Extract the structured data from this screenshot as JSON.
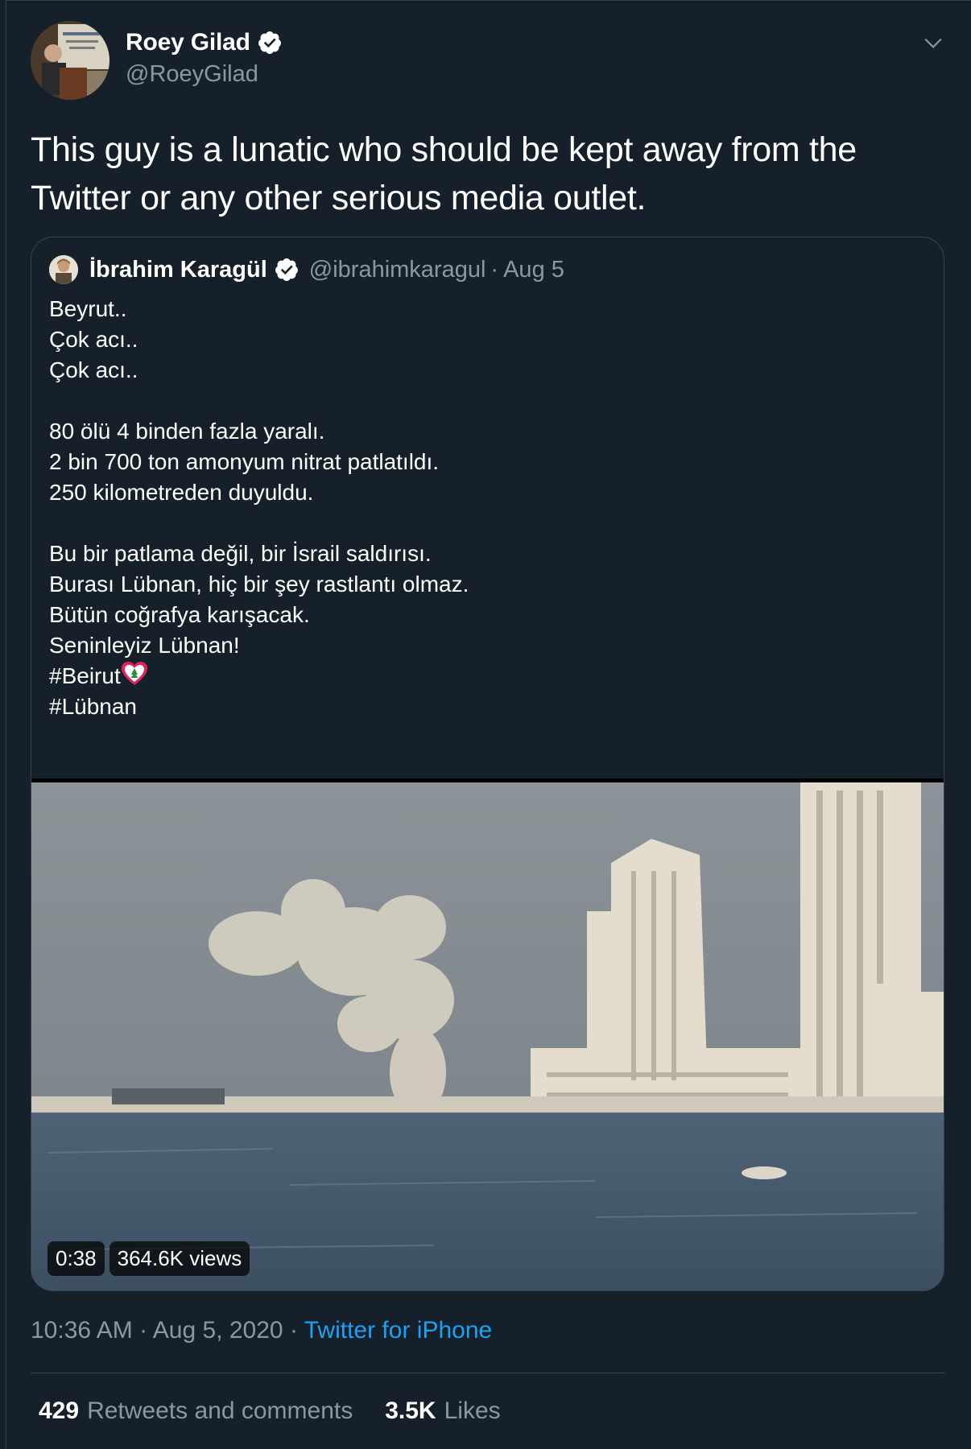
{
  "tweet": {
    "author_name": "Roey Gilad",
    "author_handle": "@RoeyGilad",
    "text": "This guy is a lunatic who should be kept away from the Twitter or any other serious media outlet.",
    "time": "10:36 AM",
    "date": "Aug 5, 2020",
    "separator": "·",
    "source": "Twitter for iPhone",
    "retweets_count": "429",
    "retweets_label": "Retweets and comments",
    "likes_count": "3.5K",
    "likes_label": "Likes"
  },
  "quoted": {
    "author_name": "İbrahim Karagül",
    "author_handle": "@ibrahimkaragul",
    "separator": "·",
    "date": "Aug 5",
    "lines_1": "Beyrut..\nÇok acı..\nÇok acı..\n\n80 ölü 4 binden fazla yaralı.\n2 bin 700 ton amonyum nitrat patlatıldı.\n250 kilometreden duyuldu.\n\nBu bir patlama değil, bir İsrail saldırısı.\nBurası Lübnan, hiç bir şey rastlantı olmaz.\nBütün coğrafya karışacak.\nSeninleyiz Lübnan!\n",
    "hashtag_1": "#Beirut",
    "hashtag_2": "#Lübnan",
    "video_duration": "0:38",
    "video_views": "364.6K views"
  },
  "icons": {
    "verified": "verified-badge-icon",
    "caret": "chevron-down-icon",
    "emoji": "lebanon-flag-heart-icon"
  },
  "colors": {
    "background": "#15202b",
    "border": "#38444d",
    "secondary_text": "#8899a6",
    "link": "#1da1f2"
  }
}
